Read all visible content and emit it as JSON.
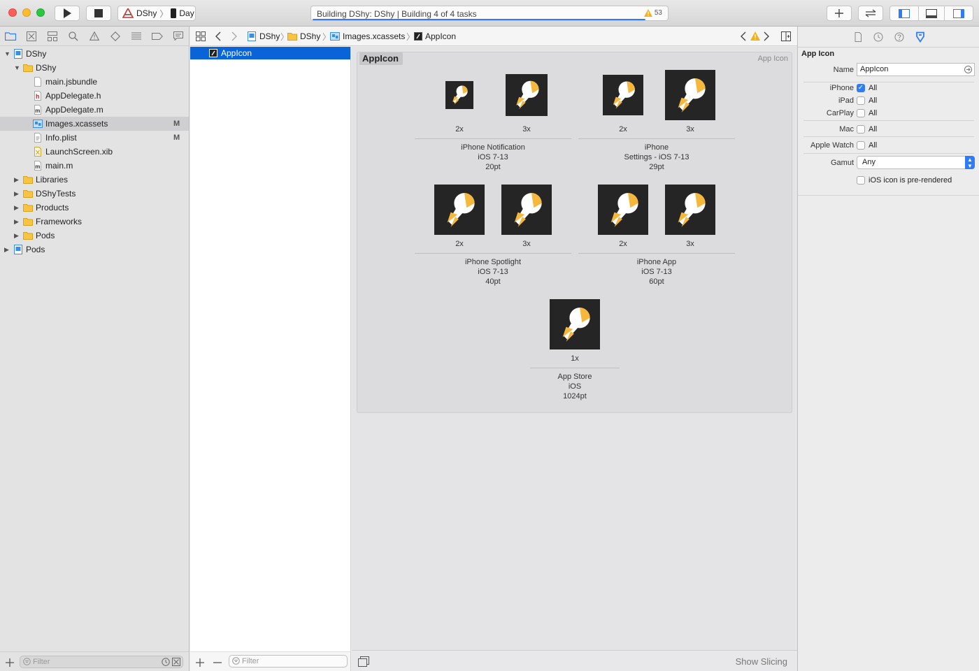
{
  "toolbar": {
    "scheme": "DShy",
    "device": "Day",
    "activity_text": "Building DShy: DShy | Building 4 of 4 tasks",
    "warning_count": "53"
  },
  "navigator": {
    "items": [
      {
        "label": "DShy",
        "flag": ""
      },
      {
        "label": "DShy",
        "flag": ""
      },
      {
        "label": "main.jsbundle",
        "flag": ""
      },
      {
        "label": "AppDelegate.h",
        "flag": ""
      },
      {
        "label": "AppDelegate.m",
        "flag": ""
      },
      {
        "label": "Images.xcassets",
        "flag": "M"
      },
      {
        "label": "Info.plist",
        "flag": "M"
      },
      {
        "label": "LaunchScreen.xib",
        "flag": ""
      },
      {
        "label": "main.m",
        "flag": ""
      },
      {
        "label": "Libraries",
        "flag": ""
      },
      {
        "label": "DShyTests",
        "flag": ""
      },
      {
        "label": "Products",
        "flag": ""
      },
      {
        "label": "Frameworks",
        "flag": ""
      },
      {
        "label": "Pods",
        "flag": ""
      },
      {
        "label": "Pods",
        "flag": ""
      }
    ],
    "filter_placeholder": "Filter"
  },
  "jumpbar": {
    "crumbs": [
      "DShy",
      "DShy",
      "Images.xcassets",
      "AppIcon"
    ]
  },
  "asset_list": {
    "selected": "AppIcon",
    "filter_placeholder": "Filter"
  },
  "editor": {
    "set_name": "AppIcon",
    "set_kind": "App Icon",
    "groups": [
      {
        "scales": [
          "2x",
          "3x"
        ],
        "desc": [
          "iPhone Notification",
          "iOS 7-13",
          "20pt"
        ]
      },
      {
        "scales": [
          "2x",
          "3x"
        ],
        "desc": [
          "iPhone",
          "Settings - iOS 7-13",
          "29pt"
        ]
      },
      {
        "scales": [
          "2x",
          "3x"
        ],
        "desc": [
          "iPhone Spotlight",
          "iOS 7-13",
          "40pt"
        ]
      },
      {
        "scales": [
          "2x",
          "3x"
        ],
        "desc": [
          "iPhone App",
          "iOS 7-13",
          "60pt"
        ]
      },
      {
        "scales": [
          "1x"
        ],
        "desc": [
          "App Store",
          "iOS",
          "1024pt"
        ]
      }
    ],
    "show_slicing": "Show Slicing"
  },
  "inspector": {
    "section_title": "App Icon",
    "name_label": "Name",
    "name_value": "AppIcon",
    "devices": [
      {
        "label": "iPhone",
        "value": "All",
        "checked": true
      },
      {
        "label": "iPad",
        "value": "All",
        "checked": false
      },
      {
        "label": "CarPlay",
        "value": "All",
        "checked": false
      },
      {
        "label": "Mac",
        "value": "All",
        "checked": false
      },
      {
        "label": "Apple Watch",
        "value": "All",
        "checked": false
      }
    ],
    "gamut_label": "Gamut",
    "gamut_value": "Any",
    "prerendered_label": "iOS icon is pre-rendered"
  },
  "colors": {
    "accent": "#2f7cf6",
    "selection": "#0a64d8",
    "icon_bg": "#252525",
    "icon_fg": "#f5b83d"
  }
}
